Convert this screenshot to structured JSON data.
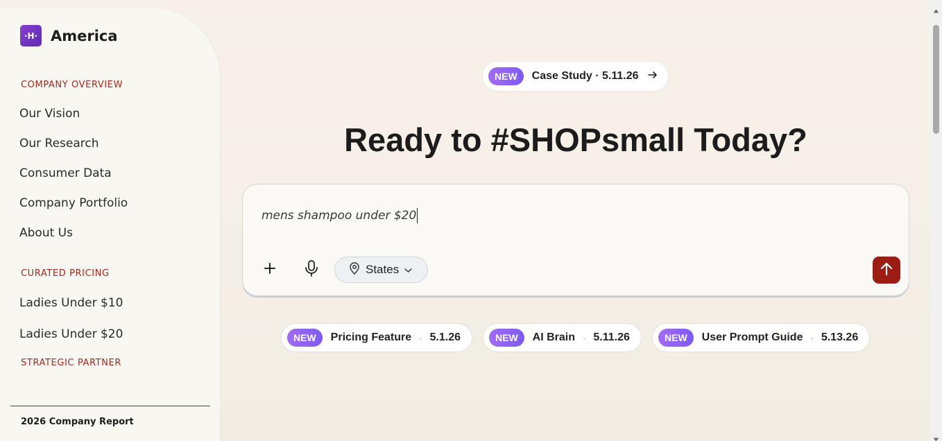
{
  "sidebar": {
    "brand": {
      "logo_text": "·H·",
      "name": "America"
    },
    "sections": {
      "company_overview": "COMPANY OVERVIEW",
      "curated_pricing": "CURATED PRICING",
      "strategic_partner": "STRATEGIC PARTNER"
    },
    "company_items": [
      "Our Vision",
      "Our Research",
      "Consumer Data",
      "Company Portfolio",
      "About Us"
    ],
    "pricing_items": [
      "Ladies Under $10",
      "Ladies Under $20"
    ],
    "footer": "2026 Company Report"
  },
  "announcement": {
    "badge": "NEW",
    "label": "Case Study · 5.11.26",
    "icon": "arrow-right-icon"
  },
  "headline": "Ready to #SHOPsmall Today?",
  "prompt": {
    "value": "mens shampoo under $20",
    "location_label": "States",
    "icons": [
      "plus-icon",
      "microphone-icon",
      "location-pin-icon",
      "chevron-down-icon",
      "arrow-up-icon"
    ]
  },
  "features": [
    {
      "badge": "NEW",
      "label": "Pricing Feature",
      "separator": "·",
      "date": "5.1.26"
    },
    {
      "badge": "NEW",
      "label": "AI Brain",
      "separator": "·",
      "date": "5.11.26"
    },
    {
      "badge": "NEW",
      "label": "User Prompt Guide",
      "separator": "·",
      "date": "5.13.26"
    }
  ],
  "colors": {
    "accent_red": "#9b1d14",
    "section_red": "#a02a1f",
    "badge_purple": "#8b5cf6",
    "logo_purple": "#6a33c0"
  }
}
